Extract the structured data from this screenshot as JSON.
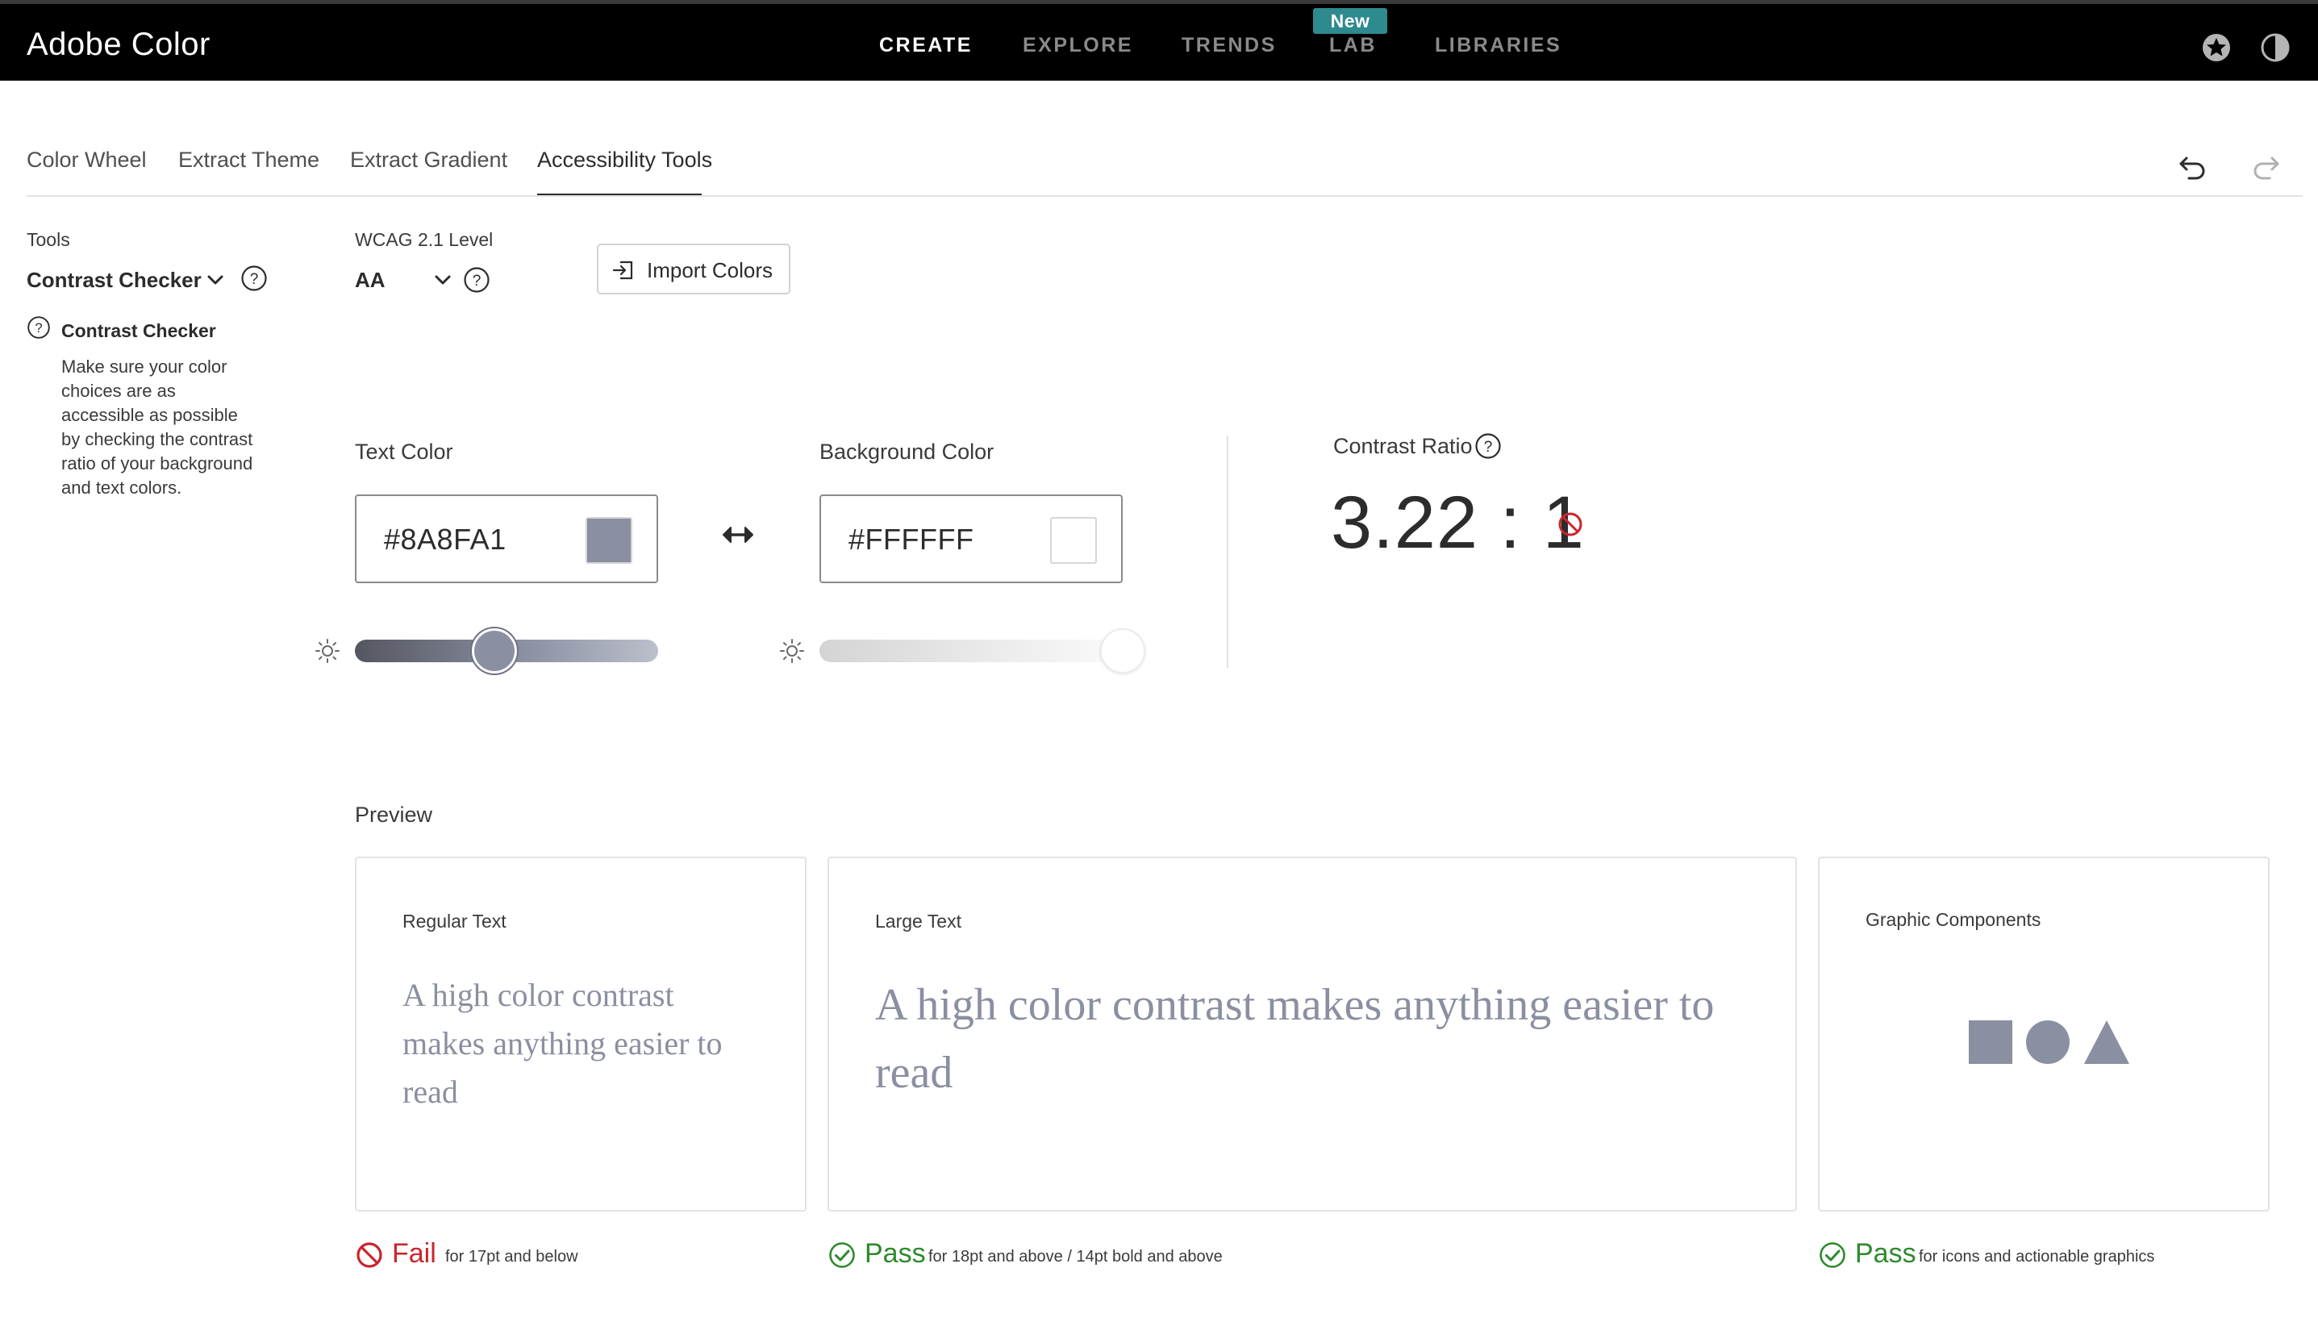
{
  "app": {
    "title": "Adobe Color"
  },
  "nav": {
    "items": [
      "CREATE",
      "EXPLORE",
      "TRENDS",
      "LAB",
      "LIBRARIES"
    ],
    "active": "CREATE",
    "new_badge": "New"
  },
  "tabs": {
    "items": [
      "Color Wheel",
      "Extract Theme",
      "Extract Gradient",
      "Accessibility Tools"
    ],
    "active": "Accessibility Tools"
  },
  "tools": {
    "label": "Tools",
    "selected": "Contrast Checker",
    "info_title": "Contrast Checker",
    "info_text": "Make sure your color choices are as accessible as possible by checking the contrast ratio of your background and text colors."
  },
  "wcag": {
    "label": "WCAG 2.1 Level",
    "value": "AA"
  },
  "import_button": {
    "label": "Import Colors"
  },
  "text_color": {
    "label": "Text Color",
    "hex": "#8A8FA1",
    "brightness": 0.46
  },
  "background_color": {
    "label": "Background Color",
    "hex": "#FFFFFF",
    "brightness": 1.0
  },
  "contrast": {
    "label": "Contrast Ratio",
    "value": "3.22 : 1",
    "status": "fail"
  },
  "preview": {
    "label": "Preview",
    "regular": {
      "title": "Regular Text",
      "sample": "A high color contrast makes anything easier to read",
      "status": "Fail",
      "desc": "for 17pt and below"
    },
    "large": {
      "title": "Large Text",
      "sample": "A high color contrast makes anything easier to read",
      "status": "Pass",
      "desc": "for 18pt and above / 14pt bold and above"
    },
    "graphic": {
      "title": "Graphic Components",
      "status": "Pass",
      "desc": "for icons and actionable graphics"
    }
  },
  "colors": {
    "fail": "#c9252d",
    "pass": "#2d8a2d",
    "badge": "#2d8a8e",
    "sample": "#8A8FA1"
  },
  "icons": {
    "top_right": [
      "star-badge-icon",
      "theme-toggle-icon"
    ],
    "history": [
      "undo-icon",
      "redo-icon"
    ]
  }
}
